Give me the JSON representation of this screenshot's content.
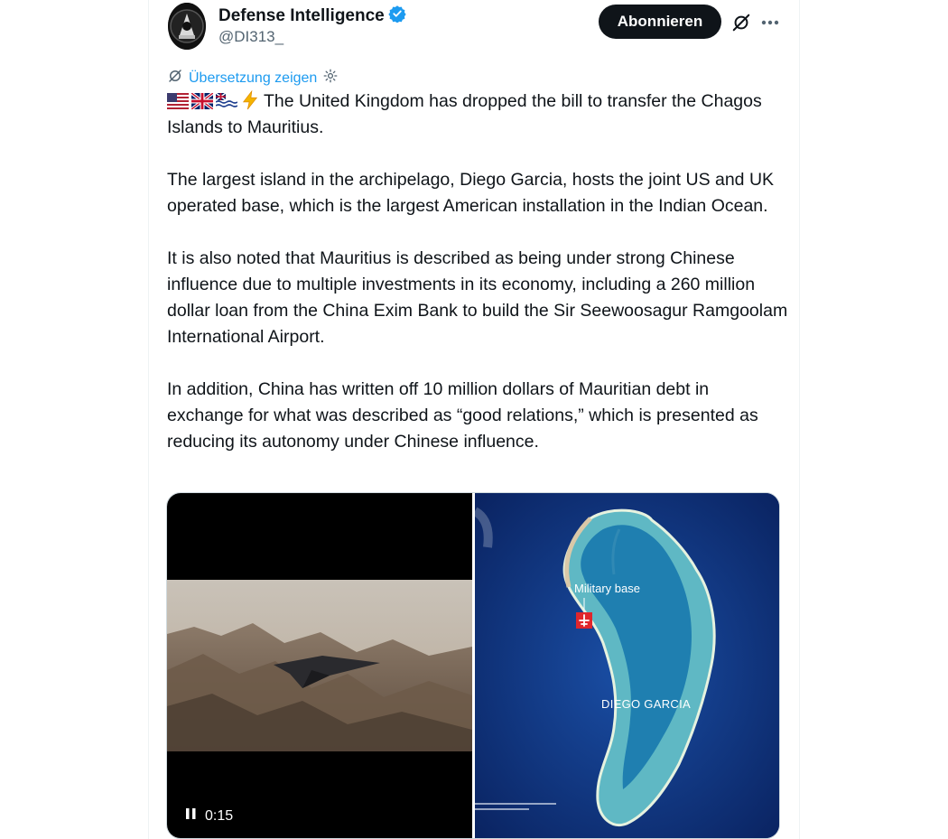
{
  "author": {
    "name": "Defense Intelligence",
    "handle": "@DI313_",
    "verified": true,
    "verified_color": "#1d9bf0"
  },
  "actions": {
    "subscribe_label": "Abonnieren",
    "grok_icon": "grok-icon",
    "more_icon": "more-icon"
  },
  "translate": {
    "label": "Übersetzung zeigen"
  },
  "tweet": {
    "flags": [
      "us-flag",
      "uk-flag",
      "biot-flag",
      "lightning"
    ],
    "p1": "The United Kingdom has dropped the bill to transfer the Chagos Islands to Mauritius.",
    "p2": "The largest island in the archipelago, Diego Garcia, hosts the joint US and UK operated base, which is the largest American installation in the Indian Ocean.",
    "p3": "It is also noted that Mauritius is described as being under strong Chinese influence due to multiple investments in its economy, including a 260 million dollar loan from the China Exim Bank to build the Sir Seewoosagur Ramgoolam International Airport.",
    "p4": "In addition, China has written off 10 million dollars of Mauritian debt in exchange for what was described as “good relations,” which is presented as reducing its autonomy under Chinese influence."
  },
  "media": {
    "video_time": "0:15",
    "map_label_base": "Military base",
    "map_label_island": "DIEGO GARCIA"
  },
  "colors": {
    "accent": "#1d9bf0",
    "text": "#0f1419",
    "muted": "#536471",
    "button_bg": "#0f1419"
  }
}
